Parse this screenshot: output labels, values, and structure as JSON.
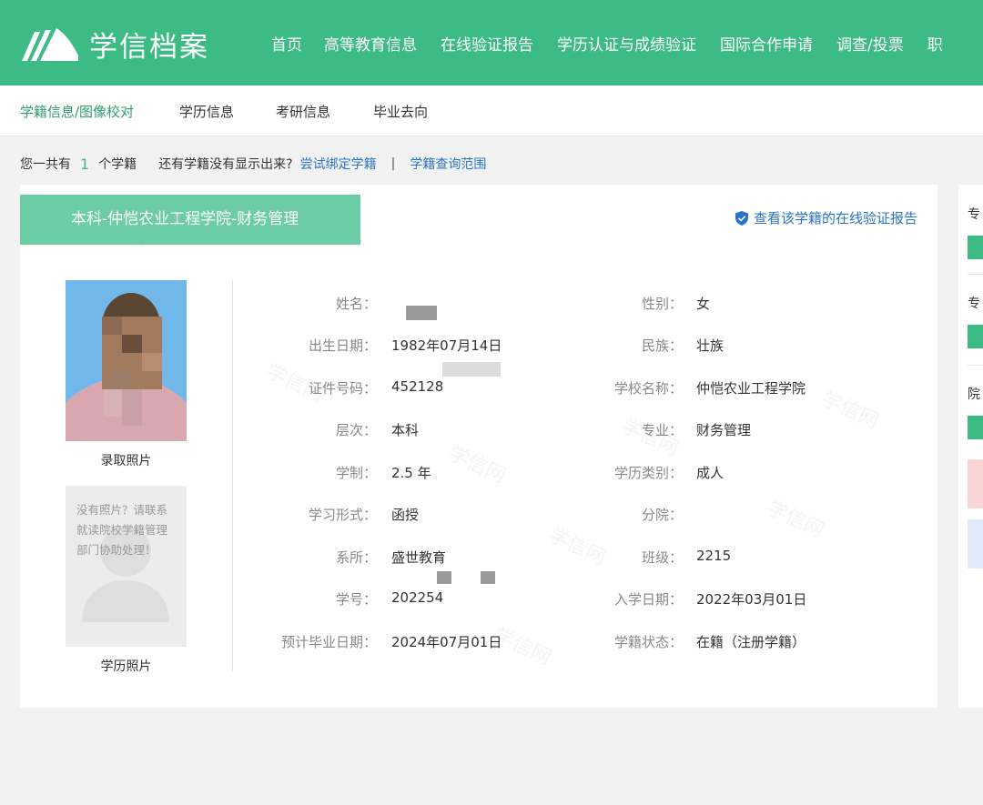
{
  "header": {
    "logo_text": "学信档案",
    "nav": [
      "首页",
      "高等教育信息",
      "在线验证报告",
      "学历认证与成绩验证",
      "国际合作申请",
      "调查/投票",
      "职"
    ]
  },
  "subtabs": [
    "学籍信息/图像校对",
    "学历信息",
    "考研信息",
    "毕业去向"
  ],
  "summary": {
    "prefix": "您一共有",
    "count": "1",
    "suffix": "个学籍",
    "hint": "还有学籍没有显示出来?",
    "bind_link": "尝试绑定学籍",
    "separator": "|",
    "scope_link": "学籍查询范围"
  },
  "card": {
    "tag": "本科-仲恺农业工程学院-财务管理",
    "verify_link": "查看该学籍的在线验证报告",
    "photo1_caption": "录取照片",
    "photo2_text": "没有照片？请联系就读院校学籍管理部门协助处理！",
    "photo2_caption": "学历照片",
    "left_fields": [
      {
        "label": "姓名：",
        "value": ""
      },
      {
        "label": "出生日期：",
        "value": "1982年07月14日"
      },
      {
        "label": "证件号码：",
        "value": "452128"
      },
      {
        "label": "层次：",
        "value": "本科"
      },
      {
        "label": "学制：",
        "value": "2.5 年"
      },
      {
        "label": "学习形式：",
        "value": "函授"
      },
      {
        "label": "系所：",
        "value": "盛世教育"
      },
      {
        "label": "学号：",
        "value": "202254"
      },
      {
        "label": "预计毕业日期：",
        "value": "2024年07月01日"
      }
    ],
    "right_fields": [
      {
        "label": "性别：",
        "value": "女"
      },
      {
        "label": "民族：",
        "value": "壮族"
      },
      {
        "label": "学校名称：",
        "value": "仲恺农业工程学院"
      },
      {
        "label": "专业：",
        "value": "财务管理"
      },
      {
        "label": "学历类别：",
        "value": "成人"
      },
      {
        "label": "分院：",
        "value": ""
      },
      {
        "label": "班级：",
        "value": "2215"
      },
      {
        "label": "入学日期：",
        "value": "2022年03月01日"
      },
      {
        "label": "学籍状态：",
        "value": "在籍（注册学籍）"
      }
    ]
  },
  "side": {
    "labels": [
      "专",
      "专",
      "院"
    ]
  },
  "watermark_text": "学信网",
  "colors": {
    "brand_green": "#3dbb84",
    "tag_green": "#6ccca5",
    "link_blue": "#2a73c9"
  }
}
